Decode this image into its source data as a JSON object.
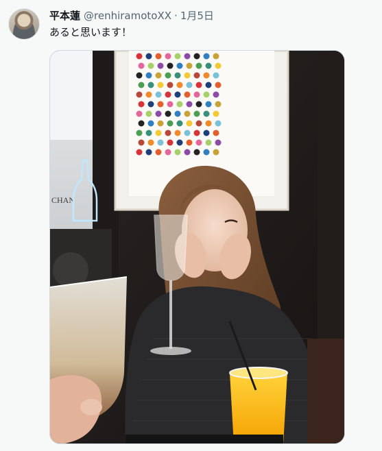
{
  "tweet": {
    "author_name": "平本蓮",
    "handle": "@renhiramotoXX",
    "separator": "·",
    "date": "1月5日",
    "text": "あると思います！",
    "avatar_icon": "user-avatar-photo",
    "media": {
      "type": "photo",
      "sign_text": "CHAN"
    }
  }
}
